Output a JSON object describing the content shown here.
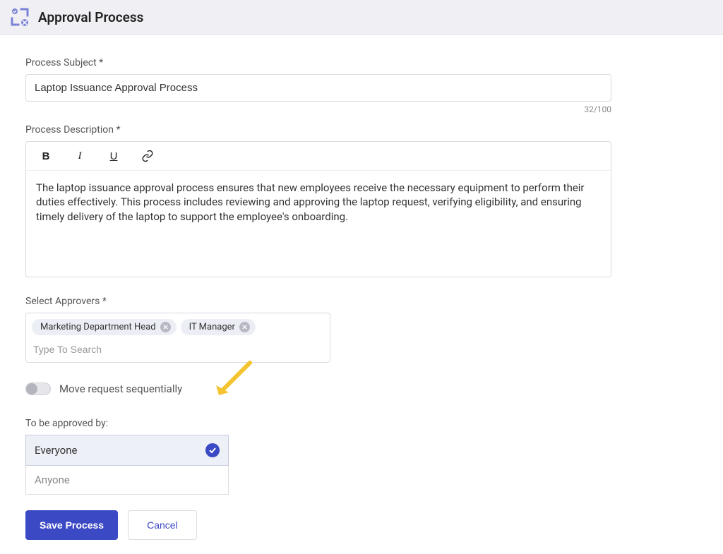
{
  "header": {
    "title": "Approval Process"
  },
  "subject": {
    "label": "Process Subject *",
    "value": "Laptop Issuance Approval Process",
    "counter": "32/100"
  },
  "description": {
    "label": "Process Description *",
    "body": "The laptop issuance approval process ensures that new employees receive the necessary equipment to perform their duties effectively. This process includes reviewing and approving the laptop request, verifying eligibility, and ensuring timely delivery of the laptop to support the employee's onboarding."
  },
  "approvers": {
    "label": "Select Approvers *",
    "chips": [
      {
        "label": "Marketing Department Head"
      },
      {
        "label": "IT Manager"
      }
    ],
    "placeholder": "Type To Search"
  },
  "sequential": {
    "label": "Move request sequentially"
  },
  "approved_by": {
    "label": "To be approved by:",
    "options": [
      {
        "label": "Everyone",
        "selected": true
      },
      {
        "label": "Anyone",
        "selected": false
      }
    ]
  },
  "buttons": {
    "save": "Save Process",
    "cancel": "Cancel"
  }
}
